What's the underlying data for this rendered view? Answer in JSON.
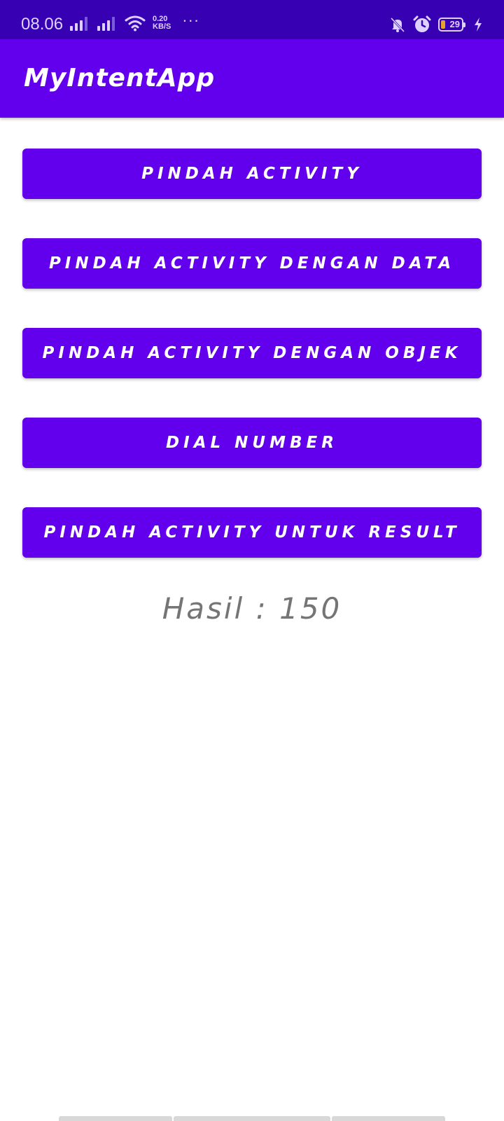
{
  "status_bar": {
    "time": "08.06",
    "net_speed_value": "0.20",
    "net_speed_unit": "KB/S",
    "overflow": "···",
    "battery_level": "29",
    "icons": [
      "signal-icon",
      "wifi-icon",
      "mute-icon",
      "alarm-icon",
      "battery-icon",
      "charging-icon"
    ]
  },
  "app_bar": {
    "title": "MyIntentApp"
  },
  "buttons": {
    "move_activity": "PINDAH ACTIVITY",
    "move_with_data": "PINDAH ACTIVITY DENGAN DATA",
    "move_with_object": "PINDAH ACTIVITY DENGAN OBJEK",
    "dial_number": "DIAL NUMBER",
    "move_for_result": "PINDAH ACTIVITY UNTUK RESULT"
  },
  "result": {
    "text": "Hasil : 150"
  },
  "colors": {
    "primary": "#6200EE",
    "primary_dark": "#3700B3",
    "result_text": "#757575"
  }
}
